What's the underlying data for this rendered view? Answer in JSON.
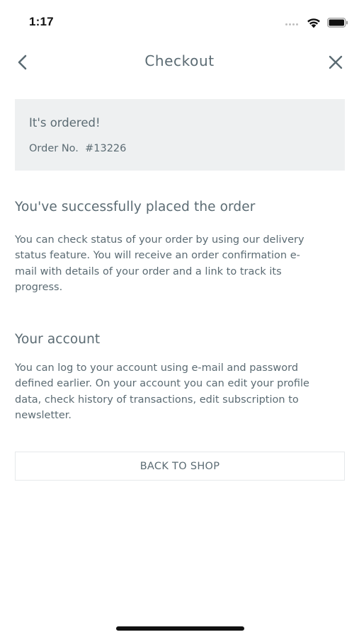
{
  "status_bar": {
    "time": "1:17"
  },
  "nav": {
    "title": "Checkout",
    "back_icon": "chevron-left-icon",
    "close_icon": "close-icon"
  },
  "order_card": {
    "heading": "It's ordered!",
    "order_label": "Order No.",
    "order_number": "#13226"
  },
  "success_section": {
    "title": "You've successfully placed the order",
    "lines": [
      "You can check status of your order by using our delivery",
      "status feature. You will receive an order confirmation e-",
      "mail with details of your order and a link to track its",
      "progress."
    ]
  },
  "account_section": {
    "title": "Your account",
    "lines": [
      "You can log to your account using e-mail and password",
      "defined earlier. On your account you can edit your profile",
      "data, check history of transactions, edit subscription to",
      "newsletter."
    ]
  },
  "actions": {
    "back_to_shop_label": "BACK TO SHOP"
  },
  "colors": {
    "text": "#5b6b73",
    "card_background": "#eef0f1",
    "button_border": "#e6e9eb"
  }
}
